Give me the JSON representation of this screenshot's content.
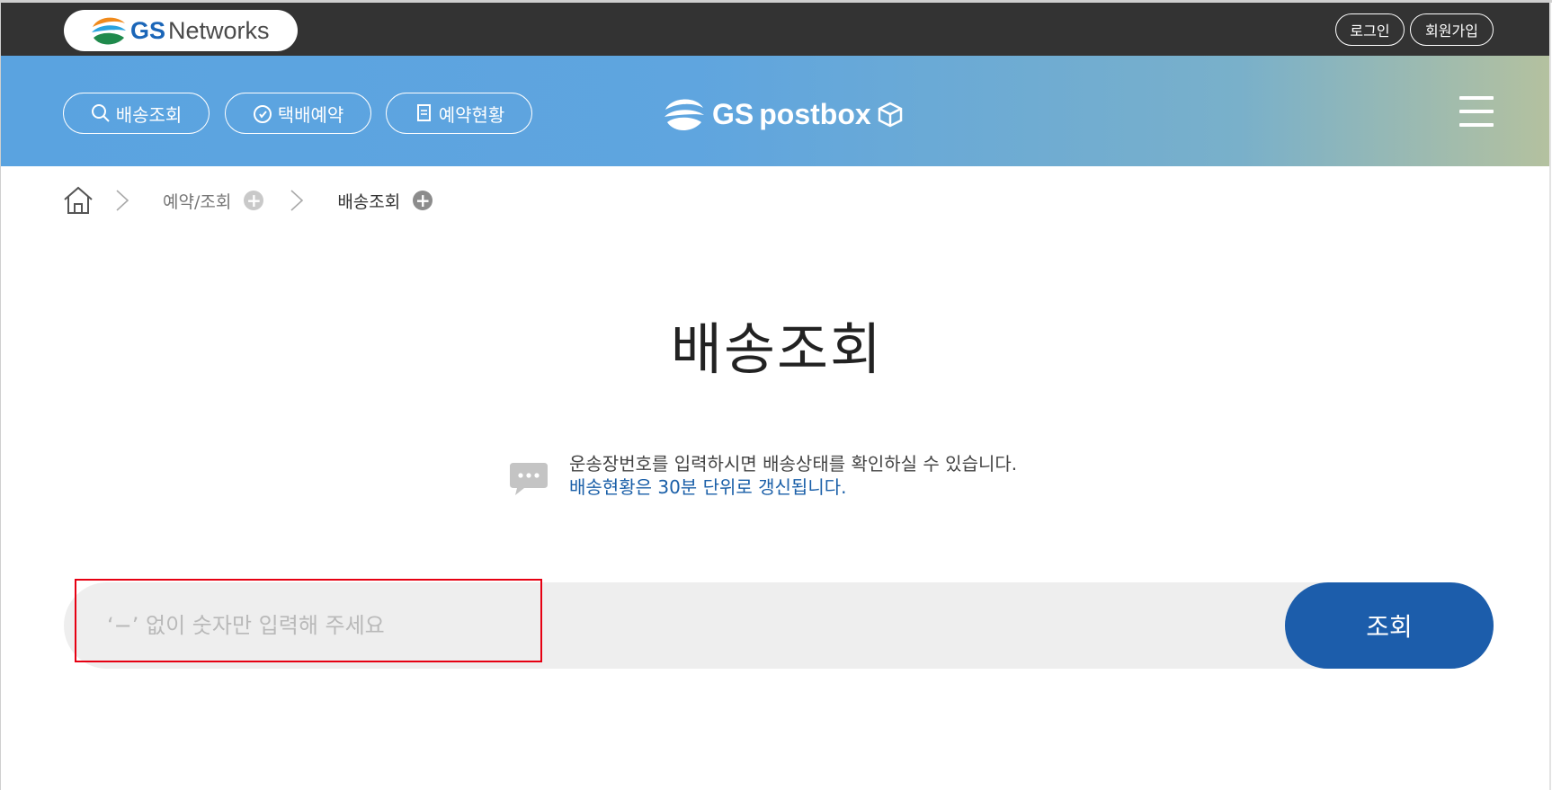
{
  "topbar": {
    "logo_gs": "GS",
    "logo_networks": "Networks",
    "login_label": "로그인",
    "join_label": "회원가입"
  },
  "nav": {
    "items": [
      {
        "label": "배송조회",
        "icon": "search-icon"
      },
      {
        "label": "택배예약",
        "icon": "clock-icon"
      },
      {
        "label": "예약현황",
        "icon": "document-icon"
      }
    ],
    "brand_gs": "GS",
    "brand_postbox": "postbox"
  },
  "breadcrumb": {
    "items": [
      "예약/조회",
      "배송조회"
    ]
  },
  "main": {
    "title": "배송조회",
    "info_line1": "운송장번호를 입력하시면 배송상태를 확인하실 수 있습니다.",
    "info_line2": "배송현황은 30분 단위로 갱신됩니다.",
    "search_placeholder": "‘−’ 없이 숫자만 입력해 주세요",
    "search_value": "",
    "search_button": "조회"
  },
  "colors": {
    "topbar": "#333333",
    "accent_blue": "#1c5dab",
    "info_blue": "#1a5fa8",
    "highlight": "#e60012"
  }
}
